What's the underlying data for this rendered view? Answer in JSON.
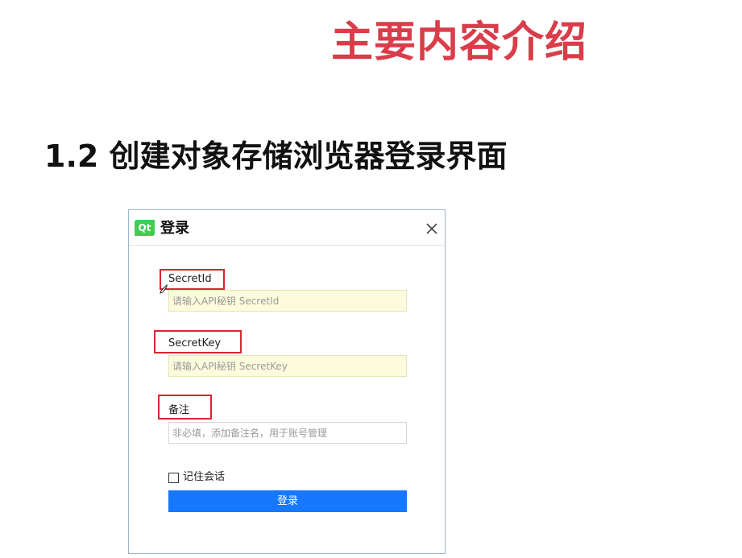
{
  "slide": {
    "title": "主要内容介绍",
    "section_heading": "1.2 创建对象存储浏览器登录界面",
    "title_color": "#d93d4a",
    "highlight_color": "#d8262f"
  },
  "dialog": {
    "logo_text": "Qt",
    "logo_icon": "qt-logo-icon",
    "title": "登录",
    "close_icon": "close-icon",
    "fields": {
      "secret_id": {
        "label": "SecretId",
        "placeholder": "请输入API秘钥 SecretId",
        "value": ""
      },
      "secret_key": {
        "label": "SecretKey",
        "placeholder": "请输入API秘钥 SecretKey",
        "value": ""
      },
      "remark": {
        "label": "备注",
        "placeholder": "非必填，添加备注名，用于账号管理",
        "value": ""
      }
    },
    "remember_label": "记住会话",
    "remember_checked": false,
    "login_button": "登录",
    "button_color": "#1677ff"
  }
}
